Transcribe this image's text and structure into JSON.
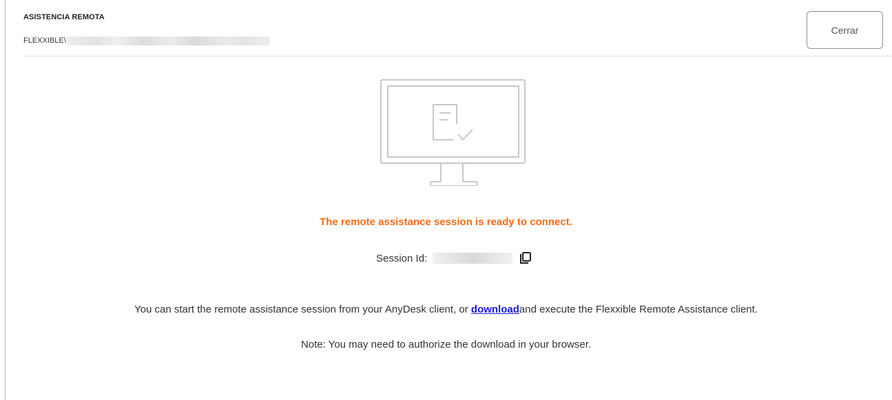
{
  "header": {
    "title": "ASISTENCIA REMOTA",
    "domain": "FLEXXIBLE\\",
    "close_label": "Cerrar"
  },
  "session": {
    "status_message": "The remote assistance session is ready to connect.",
    "session_id_label": "Session Id:"
  },
  "info": {
    "text_before": "You can start the remote assistance session from your AnyDesk client, or ",
    "download_link": "download",
    "text_after": "and execute the Flexxible Remote Assistance client.",
    "note": "Note: You may need to authorize the download in your browser."
  },
  "icons": {
    "hero": "monitor-checklist-icon",
    "copy": "copy-icon"
  },
  "colors": {
    "status": "#f26a1b",
    "link": "#1a1adb",
    "icon_stroke": "#c8c8c8"
  }
}
